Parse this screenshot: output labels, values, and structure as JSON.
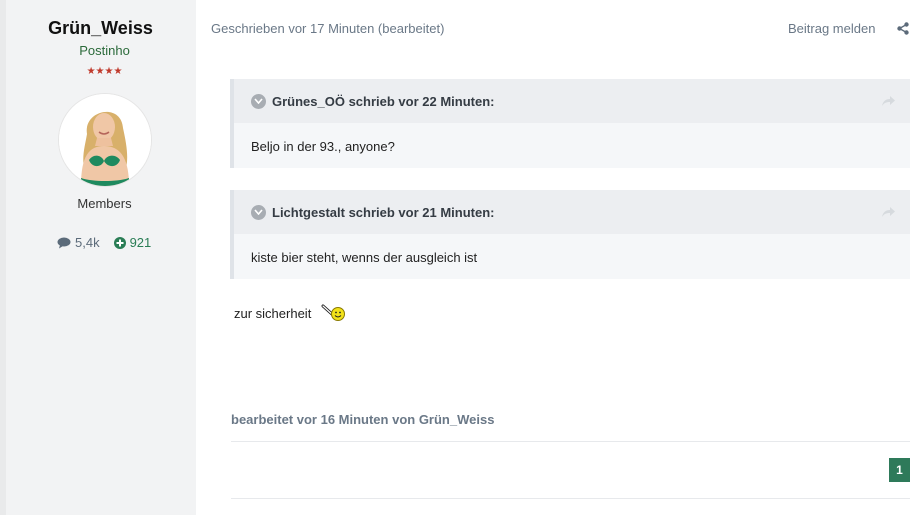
{
  "author": {
    "username": "Grün_Weiss",
    "rank": "Postinho",
    "stars": "★★★★",
    "group": "Members",
    "posts_count": "5,4k",
    "reputation": "921"
  },
  "post": {
    "meta": "Geschrieben vor 17 Minuten (bearbeitet)",
    "report_label": "Beitrag melden",
    "quotes": [
      {
        "citation": "Grünes_OÖ schrieb vor 22 Minuten:",
        "text": "Beljo in der 93., anyone?"
      },
      {
        "citation": "Lichtgestalt schrieb vor 21 Minuten:",
        "text": "kiste bier steht, wenns der ausgleich ist"
      }
    ],
    "text": "zur sicherheit",
    "edited_note": "bearbeitet vor 16 Minuten von Grün_Weiss"
  },
  "pagination": {
    "current_page": "1"
  },
  "colors": {
    "accent_green": "#2e7a5a",
    "sidebar_bg": "#f2f3f4",
    "meta_text": "#6a7887"
  }
}
